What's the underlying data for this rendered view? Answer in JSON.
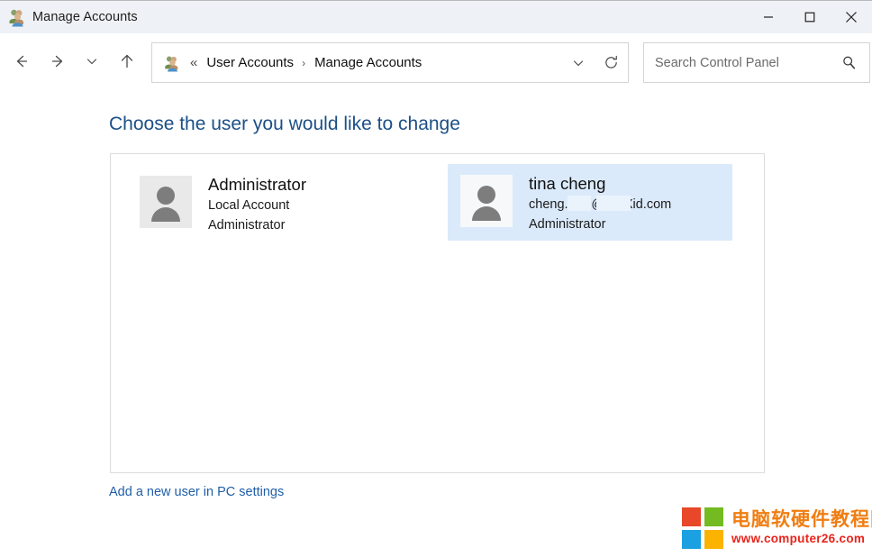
{
  "window": {
    "title": "Manage Accounts",
    "title_icon": "user-accounts-icon",
    "controls": {
      "minimize": "minimize-icon",
      "maximize": "maximize-icon",
      "close": "close-icon"
    }
  },
  "toolbar": {
    "back": "back-arrow-icon",
    "forward": "forward-arrow-icon",
    "recent": "chevron-down-icon",
    "up": "up-arrow-icon",
    "address": {
      "icon": "user-accounts-icon",
      "leading_separator": "«",
      "crumb_separator": "›",
      "crumbs": [
        {
          "label": "User Accounts"
        },
        {
          "label": "Manage Accounts"
        }
      ],
      "dropdown_icon": "chevron-down-icon",
      "refresh_icon": "refresh-icon"
    },
    "search": {
      "placeholder": "Search Control Panel",
      "value": "",
      "icon": "search-icon"
    }
  },
  "main": {
    "heading": "Choose the user you would like to change",
    "accounts": [
      {
        "name": "Administrator",
        "type": "Local Account",
        "role": "Administrator",
        "selected": false,
        "avatar": "person-avatar-icon"
      },
      {
        "name": "tina cheng",
        "email_prefix": "cheng.",
        "email_suffix": "id.com",
        "email_redacted": true,
        "role": "Administrator",
        "selected": true,
        "avatar": "person-avatar-icon"
      }
    ],
    "add_user_link": "Add a new user in PC settings"
  },
  "watermark": {
    "site_name": "电脑软硬件教程网",
    "url": "www.computer26.com",
    "logo_colors": [
      "#e8472a",
      "#73bb21",
      "#1ba0e2",
      "#fbb300"
    ]
  },
  "colors": {
    "heading": "#1c4f87",
    "link": "#1f5fa8",
    "selection": "#dbeafb",
    "titlebar": "#eef1f5"
  }
}
